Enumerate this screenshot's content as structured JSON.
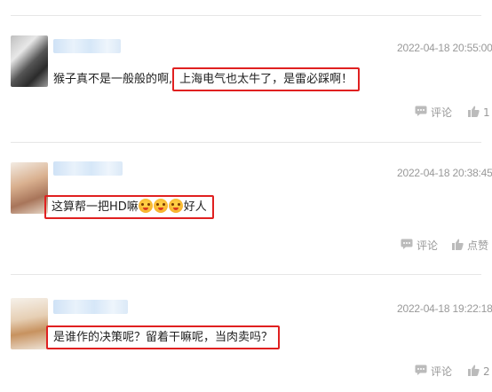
{
  "comments": [
    {
      "time": "2022-04-18 20:55:00",
      "text_plain": "猴子真不是一般般的啊,",
      "text_highlight": "上海电气也太牛了，是雷必踩啊！",
      "comment_label": "评论",
      "like_value": "1"
    },
    {
      "time": "2022-04-18 20:38:45",
      "text_prefix": "这算帮一把HD嘛",
      "text_suffix": "好人",
      "comment_label": "评论",
      "like_value": "点赞"
    },
    {
      "time": "2022-04-18 19:22:18",
      "text_highlight": "是谁作的决策呢？留着干嘛呢，当肉卖吗？",
      "comment_label": "评论",
      "like_value": "2"
    }
  ],
  "colors": {
    "highlight_border": "#e02020",
    "muted": "#999999"
  },
  "icons": [
    "comment-icon",
    "thumbs-up-icon",
    "emoji-face-icon"
  ]
}
